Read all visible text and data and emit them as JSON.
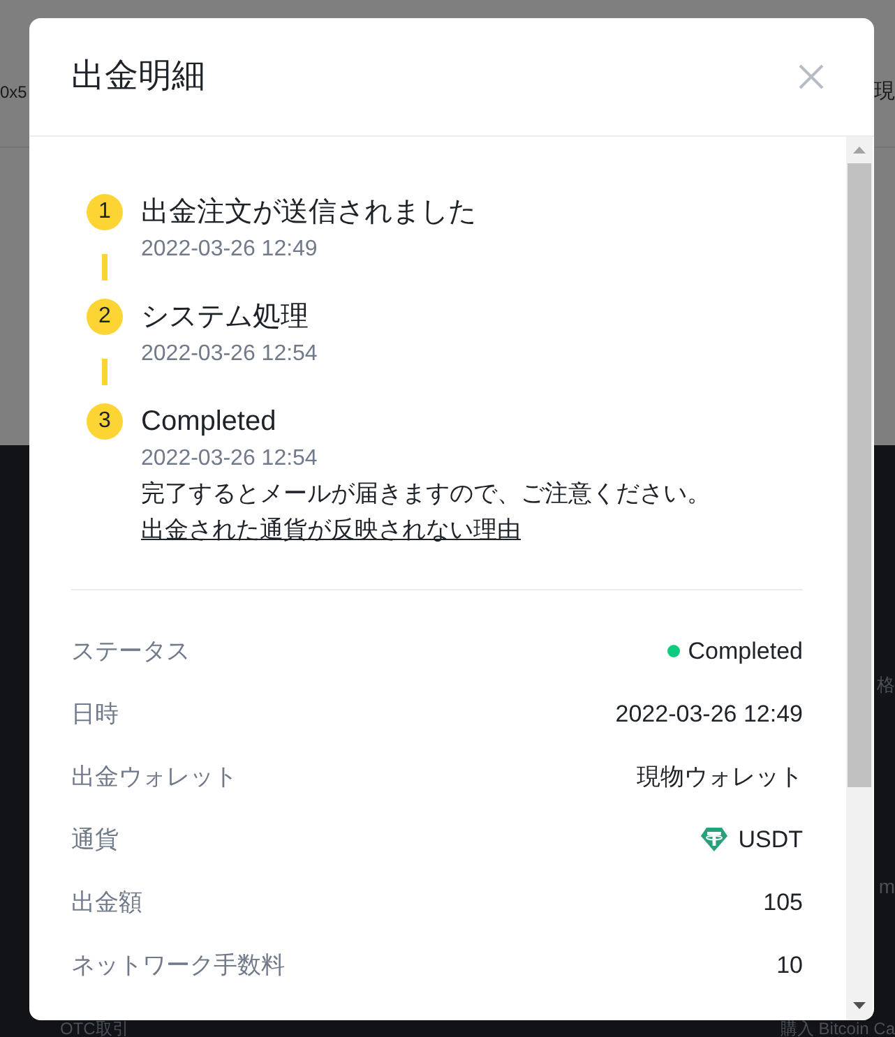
{
  "background": {
    "top_left": "0x5",
    "top_right": "現",
    "right_upper": "格",
    "right_lower": "m",
    "bottom_left": "OTC取引",
    "bottom_right": "購入 Bitcoin Ca"
  },
  "dialog": {
    "title": "出金明細"
  },
  "steps": [
    {
      "number": "1",
      "title": "出金注文が送信されました",
      "time": "2022-03-26 12:49"
    },
    {
      "number": "2",
      "title": "システム処理",
      "time": "2022-03-26 12:54"
    },
    {
      "number": "3",
      "title": "Completed",
      "time": "2022-03-26 12:54",
      "note": "完了するとメールが届きますので、ご注意ください。",
      "link": "出金された通貨が反映されない理由"
    }
  ],
  "details": [
    {
      "kind": "status",
      "label": "ステータス",
      "value": "Completed"
    },
    {
      "kind": "text",
      "label": "日時",
      "value": "2022-03-26 12:49"
    },
    {
      "kind": "text",
      "label": "出金ウォレット",
      "value": "現物ウォレット"
    },
    {
      "kind": "coin",
      "label": "通貨",
      "value": "USDT"
    },
    {
      "kind": "text",
      "label": "出金額",
      "value": "105"
    },
    {
      "kind": "text",
      "label": "ネットワーク手数料",
      "value": "10"
    }
  ]
}
